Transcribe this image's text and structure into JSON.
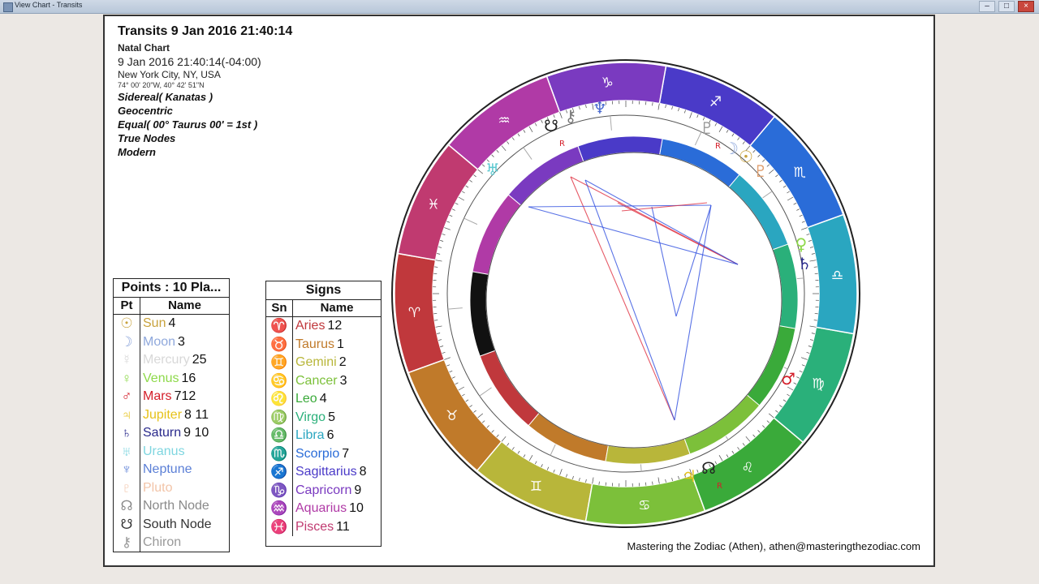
{
  "window": {
    "title": "View Chart - Transits",
    "controls": {
      "minimize": "–",
      "maximize": "□",
      "close": "×"
    }
  },
  "info": {
    "heading": "Transits 9 Jan 2016 21:40:14",
    "subheading": "Natal Chart",
    "datetime": "9 Jan 2016 21:40:14(-04:00)",
    "place": "New York City, NY, USA",
    "coords": "74° 00' 20\"W, 40° 42' 51\"N",
    "zodiac": "Sidereal( Kanatas )",
    "center": "Geocentric",
    "houses": "Equal( 00° Taurus 00' = 1st )",
    "nodes": "True Nodes",
    "rulership": "Modern"
  },
  "points_table": {
    "caption": "Points : 10 Pla...",
    "col_pt": "Pt",
    "col_name": "Name",
    "rows": [
      {
        "glyph": "☉",
        "name": "Sun",
        "num": "4",
        "color": "#c8a23c"
      },
      {
        "glyph": "☽",
        "name": "Moon",
        "num": "3",
        "color": "#8fa8dc"
      },
      {
        "glyph": "☿",
        "name": "Mercury",
        "num": "25",
        "color": "#d8d8d8"
      },
      {
        "glyph": "♀",
        "name": "Venus",
        "num": "16",
        "color": "#8ed94a"
      },
      {
        "glyph": "♂",
        "name": "Mars",
        "num": "712",
        "color": "#d41f2a"
      },
      {
        "glyph": "♃",
        "name": "Jupiter",
        "num": "8 11",
        "color": "#e6c21a"
      },
      {
        "glyph": "♄",
        "name": "Saturn",
        "num": "9 10",
        "color": "#2a2a8c"
      },
      {
        "glyph": "♅",
        "name": "Uranus",
        "num": "",
        "color": "#7fd6e0"
      },
      {
        "glyph": "♆",
        "name": "Neptune",
        "num": "",
        "color": "#5b7fd6"
      },
      {
        "glyph": "♇",
        "name": "Pluto",
        "num": "",
        "color": "#f2c4a8"
      },
      {
        "glyph": "☊",
        "name": "North Node",
        "num": "",
        "color": "#8a8a8a"
      },
      {
        "glyph": "☋",
        "name": "South Node",
        "num": "",
        "color": "#333333"
      },
      {
        "glyph": "⚷",
        "name": "Chiron",
        "num": "",
        "color": "#999999"
      }
    ]
  },
  "signs_table": {
    "caption": "Signs",
    "col_sn": "Sn",
    "col_name": "Name",
    "rows": [
      {
        "glyph": "♈",
        "name": "Aries",
        "num": "12",
        "color": "#c0383c"
      },
      {
        "glyph": "♉",
        "name": "Taurus",
        "num": "1",
        "color": "#c07a2a"
      },
      {
        "glyph": "♊",
        "name": "Gemini",
        "num": "2",
        "color": "#b8b63a"
      },
      {
        "glyph": "♋",
        "name": "Cancer",
        "num": "3",
        "color": "#7cc03a"
      },
      {
        "glyph": "♌",
        "name": "Leo",
        "num": "4",
        "color": "#3aaa3a"
      },
      {
        "glyph": "♍",
        "name": "Virgo",
        "num": "5",
        "color": "#2ab07a"
      },
      {
        "glyph": "♎",
        "name": "Libra",
        "num": "6",
        "color": "#2aa6c0"
      },
      {
        "glyph": "♏",
        "name": "Scorpio",
        "num": "7",
        "color": "#2a6cd8"
      },
      {
        "glyph": "♐",
        "name": "Sagittarius",
        "num": "8",
        "color": "#4a3ac8"
      },
      {
        "glyph": "♑",
        "name": "Capricorn",
        "num": "9",
        "color": "#7a3ac0"
      },
      {
        "glyph": "♒",
        "name": "Aquarius",
        "num": "10",
        "color": "#b03aa6"
      },
      {
        "glyph": "♓",
        "name": "Pisces",
        "num": "11",
        "color": "#c03a70"
      }
    ]
  },
  "wheel": {
    "signs": [
      {
        "glyph": "♈",
        "color": "#c0383c"
      },
      {
        "glyph": "♉",
        "color": "#c07a2a"
      },
      {
        "glyph": "♊",
        "color": "#b8b63a"
      },
      {
        "glyph": "♋",
        "color": "#7cc03a"
      },
      {
        "glyph": "♌",
        "color": "#3aaa3a"
      },
      {
        "glyph": "♍",
        "color": "#2ab07a"
      },
      {
        "glyph": "♎",
        "color": "#2aa6c0"
      },
      {
        "glyph": "♏",
        "color": "#2a6cd8"
      },
      {
        "glyph": "♐",
        "color": "#4a3ac8"
      },
      {
        "glyph": "♑",
        "color": "#7a3ac0"
      },
      {
        "glyph": "♒",
        "color": "#b03aa6"
      },
      {
        "glyph": "♓",
        "color": "#c03a70"
      }
    ],
    "retrograde_mark": "R",
    "aspect_colors": {
      "opposition": "#e03040",
      "trine": "#3050e0"
    }
  },
  "credit": "Mastering the Zodiac (Athen), athen@masteringthezodiac.com"
}
